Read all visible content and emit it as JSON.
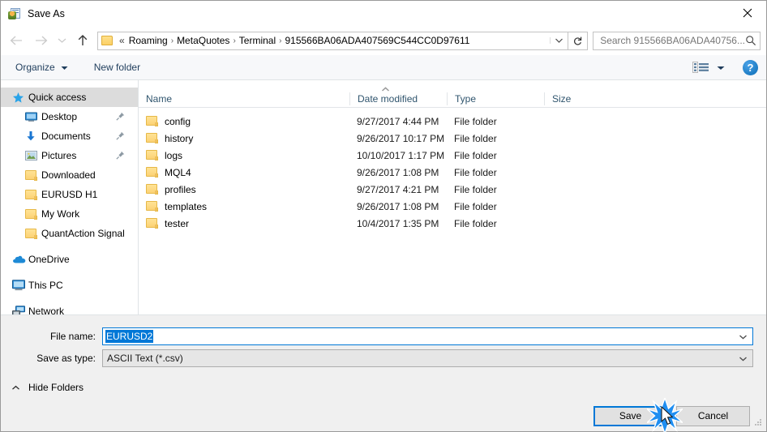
{
  "window": {
    "title": "Save As",
    "icon": "save-as-app-icon",
    "close_label": "✕"
  },
  "nav": {
    "back": "back-arrow",
    "forward": "forward-arrow",
    "recent": "recent-locations-chevron",
    "up": "up-arrow",
    "breadcrumb": {
      "leading": "«",
      "items": [
        "Roaming",
        "MetaQuotes",
        "Terminal",
        "915566BA06ADA407569C544CC0D97611"
      ],
      "separator": "›"
    },
    "address_caret": "chevron-down-icon",
    "refresh": "refresh-icon"
  },
  "search": {
    "placeholder": "Search 915566BA06ADA40756...",
    "icon": "search-icon"
  },
  "commandbar": {
    "organize": "Organize",
    "new_folder": "New folder",
    "view_icon": "view-layout-icon",
    "help": "?"
  },
  "sidebar": {
    "items": [
      {
        "label": "Quick access",
        "icon": "star-icon",
        "selected": true,
        "indent": false,
        "pinned": false,
        "group": false
      },
      {
        "label": "Desktop",
        "icon": "desktop-icon",
        "selected": false,
        "indent": true,
        "pinned": true,
        "group": false
      },
      {
        "label": "Documents",
        "icon": "documents-arrow-icon",
        "selected": false,
        "indent": true,
        "pinned": true,
        "group": false
      },
      {
        "label": "Pictures",
        "icon": "pictures-icon",
        "selected": false,
        "indent": true,
        "pinned": true,
        "group": false
      },
      {
        "label": "Downloaded",
        "icon": "folder-icon",
        "selected": false,
        "indent": true,
        "pinned": false,
        "group": false
      },
      {
        "label": "EURUSD H1",
        "icon": "folder-icon",
        "selected": false,
        "indent": true,
        "pinned": false,
        "group": false
      },
      {
        "label": "My Work",
        "icon": "folder-icon",
        "selected": false,
        "indent": true,
        "pinned": false,
        "group": false
      },
      {
        "label": "QuantAction Signal",
        "icon": "folder-icon",
        "selected": false,
        "indent": true,
        "pinned": false,
        "group": false
      },
      {
        "label": "OneDrive",
        "icon": "onedrive-cloud-icon",
        "selected": false,
        "indent": false,
        "pinned": false,
        "group": true
      },
      {
        "label": "This PC",
        "icon": "this-pc-icon",
        "selected": false,
        "indent": false,
        "pinned": false,
        "group": true
      },
      {
        "label": "Network",
        "icon": "network-icon",
        "selected": false,
        "indent": false,
        "pinned": false,
        "group": true
      }
    ]
  },
  "filelist": {
    "sort_indicator": "ascending-chevron",
    "columns": [
      "Name",
      "Date modified",
      "Type",
      "Size"
    ],
    "rows": [
      {
        "name": "config",
        "date": "9/27/2017 4:44 PM",
        "type": "File folder",
        "size": ""
      },
      {
        "name": "history",
        "date": "9/26/2017 10:17 PM",
        "type": "File folder",
        "size": ""
      },
      {
        "name": "logs",
        "date": "10/10/2017 1:17 PM",
        "type": "File folder",
        "size": ""
      },
      {
        "name": "MQL4",
        "date": "9/26/2017 1:08 PM",
        "type": "File folder",
        "size": ""
      },
      {
        "name": "profiles",
        "date": "9/27/2017 4:21 PM",
        "type": "File folder",
        "size": ""
      },
      {
        "name": "templates",
        "date": "9/26/2017 1:08 PM",
        "type": "File folder",
        "size": ""
      },
      {
        "name": "tester",
        "date": "10/4/2017 1:35 PM",
        "type": "File folder",
        "size": ""
      }
    ]
  },
  "footer": {
    "filename_label": "File name:",
    "filename_value": "EURUSD2",
    "filetype_label": "Save as type:",
    "filetype_value": "ASCII Text (*.csv)",
    "hide_folders": "Hide Folders",
    "save_label": "Save",
    "cancel_label": "Cancel"
  },
  "colors": {
    "accent": "#0078d7",
    "selection": "#0078d7",
    "folder": "#fcd275",
    "header_text": "#30556e"
  }
}
